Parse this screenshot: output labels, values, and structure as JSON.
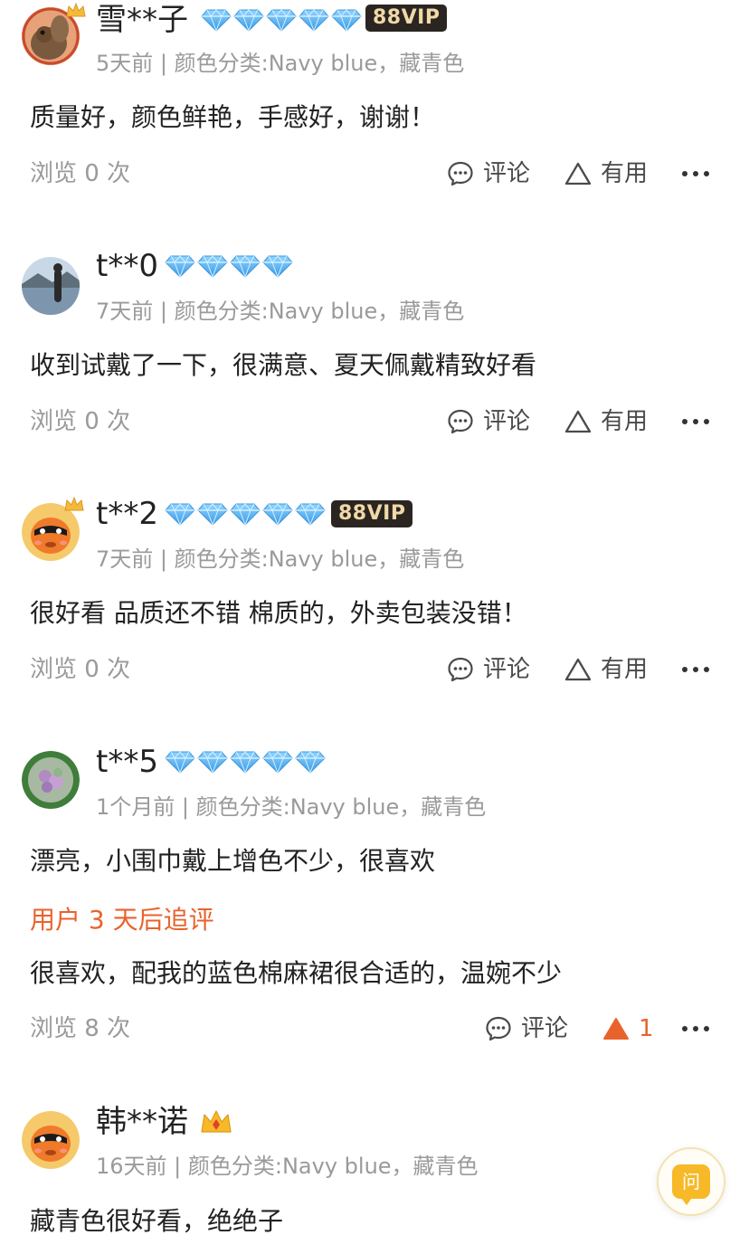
{
  "reviews": [
    {
      "username": "雪**子",
      "diamonds": 5,
      "vip_badge": "88VIP",
      "meta": "5天前 | 颜色分类:Navy blue，藏青色",
      "content": "质量好，颜色鲜艳，手感好，谢谢！",
      "views": "浏览 0 次",
      "comment_label": "评论",
      "useful_label": "有用"
    },
    {
      "username": "t**0",
      "diamonds": 4,
      "meta": "7天前 | 颜色分类:Navy blue，藏青色",
      "content": "收到试戴了一下，很满意、夏天佩戴精致好看",
      "views": "浏览 0 次",
      "comment_label": "评论",
      "useful_label": "有用"
    },
    {
      "username": "t**2",
      "diamonds": 5,
      "vip_badge": "88VIP",
      "meta": "7天前 | 颜色分类:Navy blue，藏青色",
      "content": "很好看 品质还不错 棉质的，外卖包装没错！",
      "views": "浏览 0 次",
      "comment_label": "评论",
      "useful_label": "有用"
    },
    {
      "username": "t**5",
      "diamonds": 5,
      "meta": "1个月前 | 颜色分类:Navy blue，藏青色",
      "content": "漂亮，小围巾戴上增色不少，很喜欢",
      "followup_label": "用户 3 天后追评",
      "followup_content": "很喜欢，配我的蓝色棉麻裙很合适的，温婉不少",
      "views": "浏览 8 次",
      "comment_label": "评论",
      "useful_count": "1"
    },
    {
      "username": "韩**诺",
      "meta": "16天前 | 颜色分类:Navy blue，藏青色",
      "content": "藏青色很好看，绝绝子"
    }
  ],
  "ask_button": {
    "label": "问",
    "icon": "question-chat-icon"
  },
  "colors": {
    "accent_orange": "#e9622c",
    "diamond_blue": "#5ab4f0",
    "vip_bg": "#2b2521",
    "vip_text": "#f0d9a8",
    "meta_gray": "#9a9a9a",
    "ask_yellow": "#f7b928"
  }
}
